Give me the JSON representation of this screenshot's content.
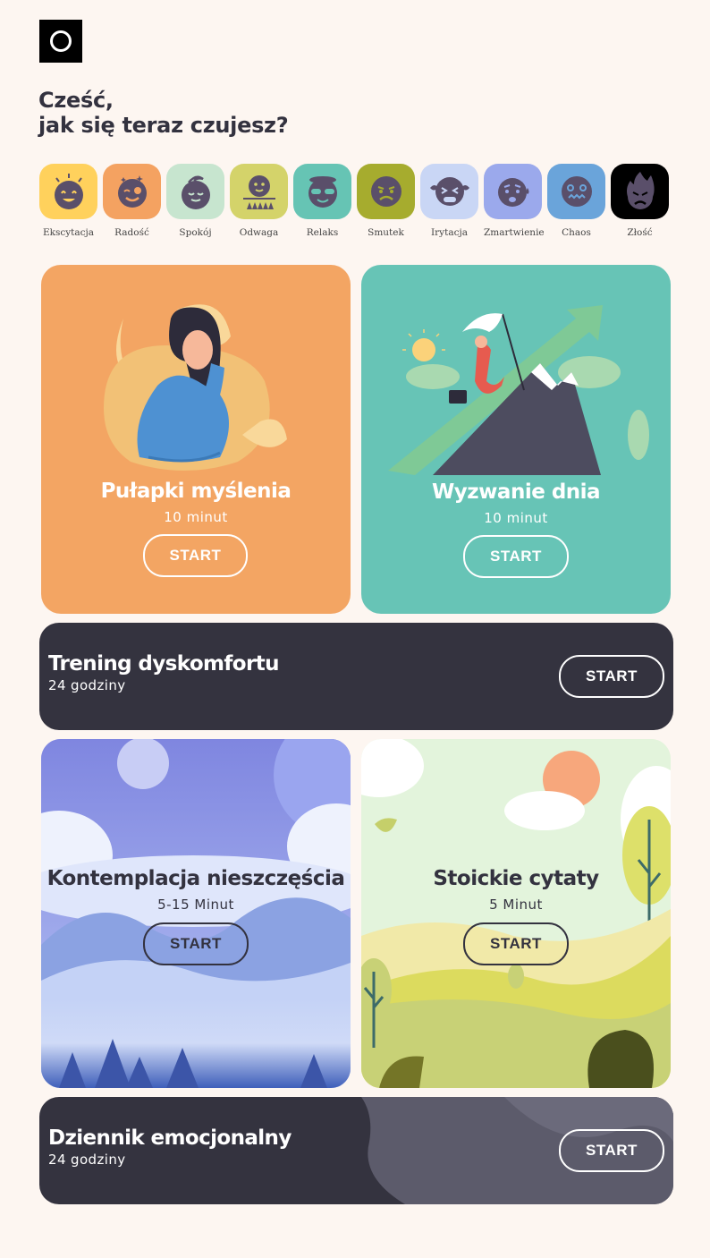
{
  "greeting": {
    "line1": "Cześć,",
    "line2": "jak się teraz czujesz?"
  },
  "moods": [
    {
      "label": "Ekscytacja",
      "color": "#ffd15c",
      "icon": "excited-face-icon"
    },
    {
      "label": "Radość",
      "color": "#f4a261",
      "icon": "wink-face-icon"
    },
    {
      "label": "Spokój",
      "color": "#c7e5cf",
      "icon": "calm-face-icon"
    },
    {
      "label": "Odwaga",
      "color": "#d4d36a",
      "icon": "brave-face-icon"
    },
    {
      "label": "Relaks",
      "color": "#66c4b4",
      "icon": "relaxed-face-icon"
    },
    {
      "label": "Smutek",
      "color": "#a6ac2e",
      "icon": "sad-face-icon"
    },
    {
      "label": "Irytacja",
      "color": "#c9d6f5",
      "icon": "irritated-face-icon"
    },
    {
      "label": "Zmartwienie",
      "color": "#9ba9ec",
      "icon": "worried-face-icon"
    },
    {
      "label": "Chaos",
      "color": "#6aa4da",
      "icon": "chaos-face-icon"
    },
    {
      "label": "Złość",
      "color": "#000000",
      "icon": "angry-fire-icon"
    }
  ],
  "cards": {
    "thinking_traps": {
      "title": "Pułapki myślenia",
      "duration": "10 minut",
      "button": "START",
      "color": "#f3a563"
    },
    "daily_challenge": {
      "title": "Wyzwanie dnia",
      "duration": "10 minut",
      "button": "START",
      "color": "#67c4b6"
    },
    "discomfort_training": {
      "title": "Trening dyskomfortu",
      "duration": "24 godziny",
      "button": "START"
    },
    "misfortune": {
      "title": "Kontemplacja nieszczęścia",
      "duration": "5-15 Minut",
      "button": "START"
    },
    "stoic_quotes": {
      "title": "Stoickie cytaty",
      "duration": "5 Minut",
      "button": "START"
    },
    "emotional_journal": {
      "title": "Dziennik emocjonalny",
      "duration": "24 godziny",
      "button": "START"
    }
  }
}
